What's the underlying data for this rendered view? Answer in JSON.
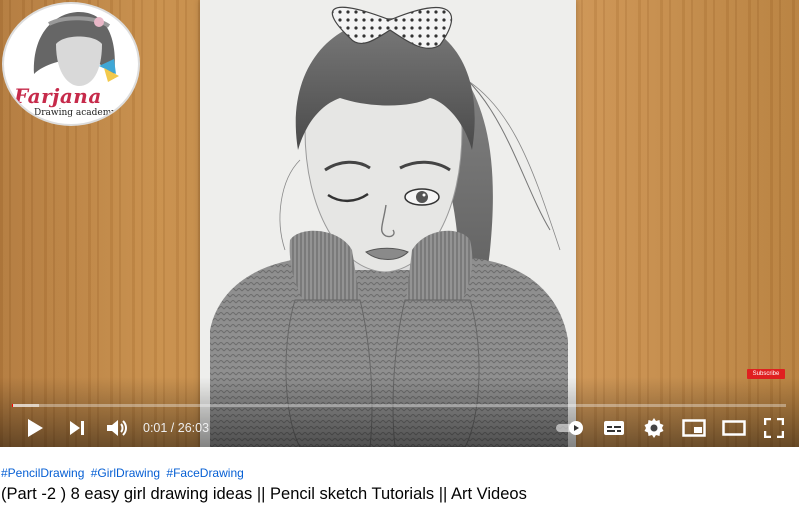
{
  "channel_logo": {
    "name": "Farjana",
    "subtitle": "Drawing academy"
  },
  "subscribe_watermark": "Subscribe",
  "player": {
    "current_time": "0:01",
    "duration": "26:03",
    "time_display": "0:01 / 26:03",
    "progress_played_fraction": 0.001,
    "progress_loaded_fraction": 0.035,
    "autoplay_on": true,
    "controls": [
      "play-icon",
      "next-icon",
      "volume-icon",
      "autoplay-toggle",
      "subtitles-icon",
      "settings-icon",
      "miniplayer-icon",
      "theater-icon",
      "fullscreen-icon"
    ]
  },
  "video": {
    "hashtags": [
      "#PencilDrawing",
      "#GirlDrawing",
      "#FaceDrawing"
    ],
    "title": "(Part -2 ) 8 easy girl drawing ideas || Pencil sketch Tutorials || Art Videos"
  },
  "colors": {
    "progress_played": "#ff0000",
    "hashtag": "#065fd4",
    "title": "#030303",
    "logo_name": "#c62a4a"
  }
}
